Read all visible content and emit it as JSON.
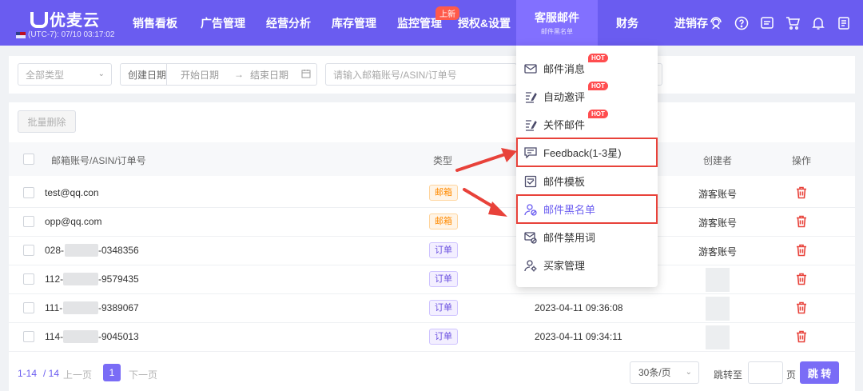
{
  "brand": {
    "name": "优麦云",
    "clock": "(UTC-7): 07/10 03:17:02"
  },
  "nav": {
    "items": [
      "销售看板",
      "广告管理",
      "经营分析",
      "库存管理",
      "监控管理",
      "授权&设置",
      "客服邮件",
      "财务",
      "进销存"
    ],
    "new_badge": "上新",
    "active_sub": "邮件黑名单"
  },
  "filter": {
    "type_select": "全部类型",
    "date_label": "创建日期",
    "start_date": "开始日期",
    "end_date": "结束日期",
    "search_placeholder": "请输入邮箱账号/ASIN/订单号"
  },
  "table": {
    "batch_delete": "批量删除",
    "headers": {
      "account": "邮箱账号/ASIN/订单号",
      "type": "类型",
      "creator": "创建者",
      "action": "操作"
    },
    "rows": [
      {
        "account": "test@qq.con",
        "type": "邮箱",
        "date": "",
        "creator": "游客账号"
      },
      {
        "account": "opp@qq.com",
        "type": "邮箱",
        "date": "",
        "creator": "游客账号"
      },
      {
        "account": "028-",
        "account_tail": "-0348356",
        "type": "订单",
        "date": "",
        "creator": "游客账号"
      },
      {
        "account": "112-",
        "account_tail": "-9579435",
        "type": "订单",
        "date": "",
        "creator": ""
      },
      {
        "account": "111-",
        "account_tail": "-9389067",
        "type": "订单",
        "date": "2023-04-11 09:36:08",
        "creator": ""
      },
      {
        "account": "114-",
        "account_tail": "-9045013",
        "type": "订单",
        "date": "2023-04-11 09:34:11",
        "creator": ""
      }
    ]
  },
  "pagination": {
    "range": "1-14",
    "total": "/ 14",
    "prev": "上一页",
    "current": "1",
    "next": "下一页",
    "page_size": "30条/页",
    "jump_label": "跳转至",
    "page_unit": "页",
    "go": "跳 转"
  },
  "menu": {
    "items": [
      "邮件消息",
      "自动邀评",
      "关怀邮件",
      "Feedback(1-3星)",
      "邮件模板",
      "邮件黑名单",
      "邮件禁用词",
      "买家管理"
    ],
    "hot_label": "HOT"
  },
  "colors": {
    "nav_bg": "#6a5cf0",
    "accent": "#7a6cf6",
    "highlight": "#e8423a",
    "delete": "#e8423a"
  }
}
